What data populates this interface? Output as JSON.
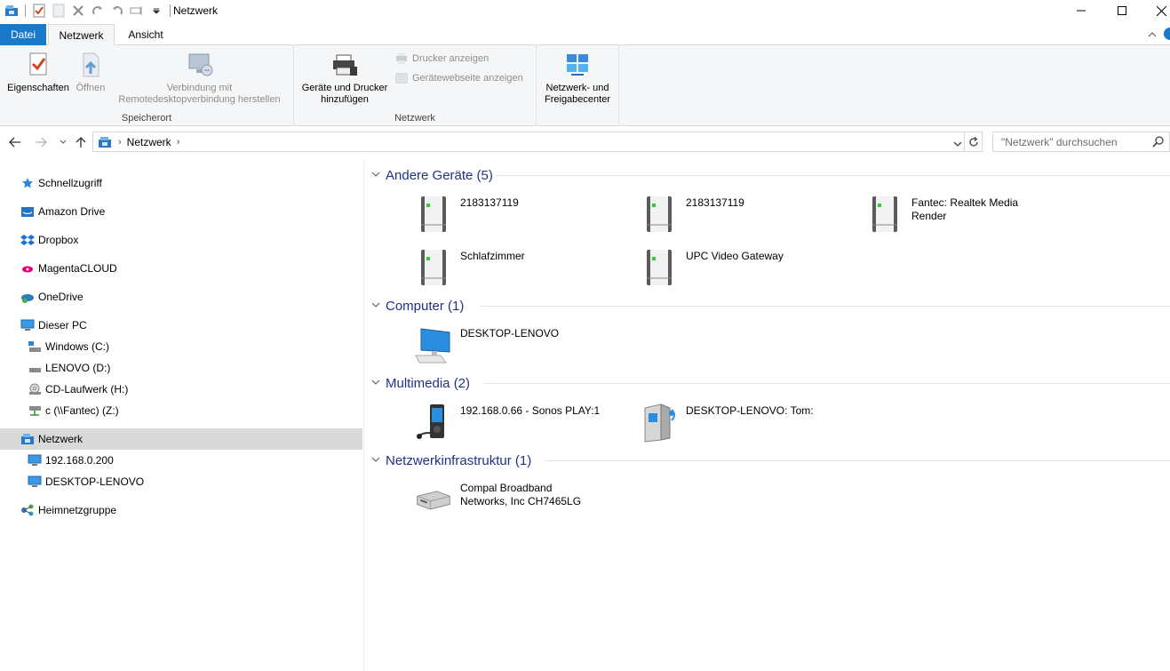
{
  "window": {
    "title": "Netzwerk",
    "controls": {
      "minimize": "—",
      "maximize": "☐",
      "close": "✕"
    }
  },
  "ribbon": {
    "tabs": [
      "Datei",
      "Netzwerk",
      "Ansicht"
    ],
    "groups": {
      "speicherort": {
        "label": "Speicherort",
        "eigenschaften": "Eigenschaften",
        "oeffnen": "Öffnen",
        "verbindung_line1": "Verbindung mit",
        "verbindung_line2": "Remotedesktopverbindung herstellen"
      },
      "netzwerk": {
        "label": "Netzwerk",
        "geraete_line1": "Geräte und Drucker",
        "geraete_line2": "hinzufügen",
        "drucker_anzeigen": "Drucker anzeigen",
        "geraetewebseite": "Gerätewebseite anzeigen"
      },
      "center": {
        "line1": "Netzwerk- und",
        "line2": "Freigabecenter"
      }
    }
  },
  "addressbar": {
    "breadcrumb": "Netzwerk",
    "search_placeholder": "\"Netzwerk\" durchsuchen"
  },
  "sidebar": {
    "items": [
      {
        "label": "Schnellzugriff",
        "icon": "star-icon"
      },
      {
        "label": "Amazon Drive",
        "icon": "amazon-drive-icon"
      },
      {
        "label": "Dropbox",
        "icon": "dropbox-icon"
      },
      {
        "label": "MagentaCLOUD",
        "icon": "magentacloud-icon"
      },
      {
        "label": "OneDrive",
        "icon": "onedrive-icon"
      },
      {
        "label": "Dieser PC",
        "icon": "pc-icon"
      },
      {
        "label": "Windows (C:)",
        "icon": "drive-icon"
      },
      {
        "label": "LENOVO (D:)",
        "icon": "drive-icon"
      },
      {
        "label": "CD-Laufwerk (H:)",
        "icon": "cd-drive-icon"
      },
      {
        "label": "c (\\\\Fantec) (Z:)",
        "icon": "network-drive-icon"
      },
      {
        "label": "Netzwerk",
        "icon": "network-icon",
        "selected": true
      },
      {
        "label": "192.168.0.200",
        "icon": "monitor-icon"
      },
      {
        "label": "DESKTOP-LENOVO",
        "icon": "monitor-icon"
      },
      {
        "label": "Heimnetzgruppe",
        "icon": "homegroup-icon"
      }
    ]
  },
  "content": {
    "groups": [
      {
        "title": "Andere Geräte (5)"
      },
      {
        "title": "Computer (1)"
      },
      {
        "title": "Multimedia (2)"
      },
      {
        "title": "Netzwerkinfrastruktur (1)"
      }
    ],
    "devices": {
      "other1": "2183137119",
      "other2": "2183137119",
      "other3_line1": "Fantec: Realtek Media",
      "other3_line2": "Render",
      "other4": "Schlafzimmer",
      "other5": "UPC Video Gateway",
      "computer1": "DESKTOP-LENOVO",
      "media1": "192.168.0.66 - Sonos PLAY:1",
      "media2": "DESKTOP-LENOVO: Tom:",
      "infra1_line1": "Compal Broadband",
      "infra1_line2": "Networks, Inc CH7465LG"
    }
  },
  "colors": {
    "accent": "#1979ca",
    "group_heading": "#1e3287",
    "selected_bg": "#d9d9d9",
    "ribbon_bg": "#f5f6f7"
  }
}
